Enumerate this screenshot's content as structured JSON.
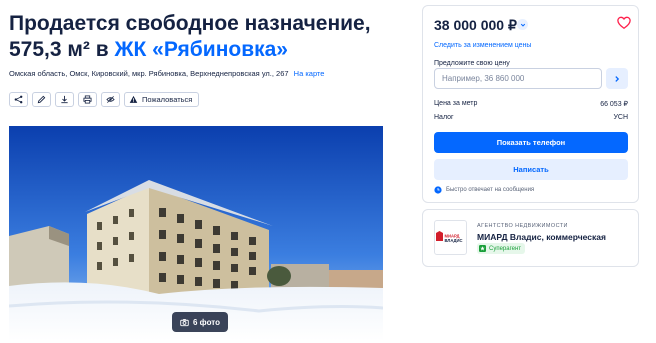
{
  "header": {
    "title_prefix": "Продается свободное назначение, 575,3 м² в",
    "title_link": "ЖК «Рябиновка»",
    "address": "Омская область, Омск, Кировский, мкр. Рябиновка, Верхнеднепровская ул., 267",
    "map_link": "На карте"
  },
  "actions": {
    "share_icon": "share-icon",
    "edit_icon": "pencil-icon",
    "download_icon": "download-icon",
    "print_icon": "print-icon",
    "hide_icon": "eye-off-icon",
    "complain_label": "Пожаловаться"
  },
  "gallery": {
    "photo_count_label": "6 фото"
  },
  "price_card": {
    "price": "38 000 000 ₽",
    "follow_label": "Следить за изменением цены",
    "offer_label": "Предложите свою цену",
    "offer_placeholder": "Например, 36 860 000",
    "rows": [
      {
        "label": "Цена за метр",
        "value": "66 053 ₽"
      },
      {
        "label": "Налог",
        "value": "УСН"
      }
    ],
    "phone_button": "Показать телефон",
    "write_button": "Написать",
    "reply_note": "Быстро отвечает на сообщения"
  },
  "agent": {
    "type": "АГЕНТСТВО НЕДВИЖИМОСТИ",
    "name": "МИАРД Владис, коммерческая",
    "badge": "Суперагент",
    "logo_text": "МИАРД ВЛАДИС"
  },
  "colors": {
    "accent": "#0468ff",
    "text": "#152242",
    "heart": "#ff1f4b",
    "badge_green": "#1a9f3a"
  }
}
